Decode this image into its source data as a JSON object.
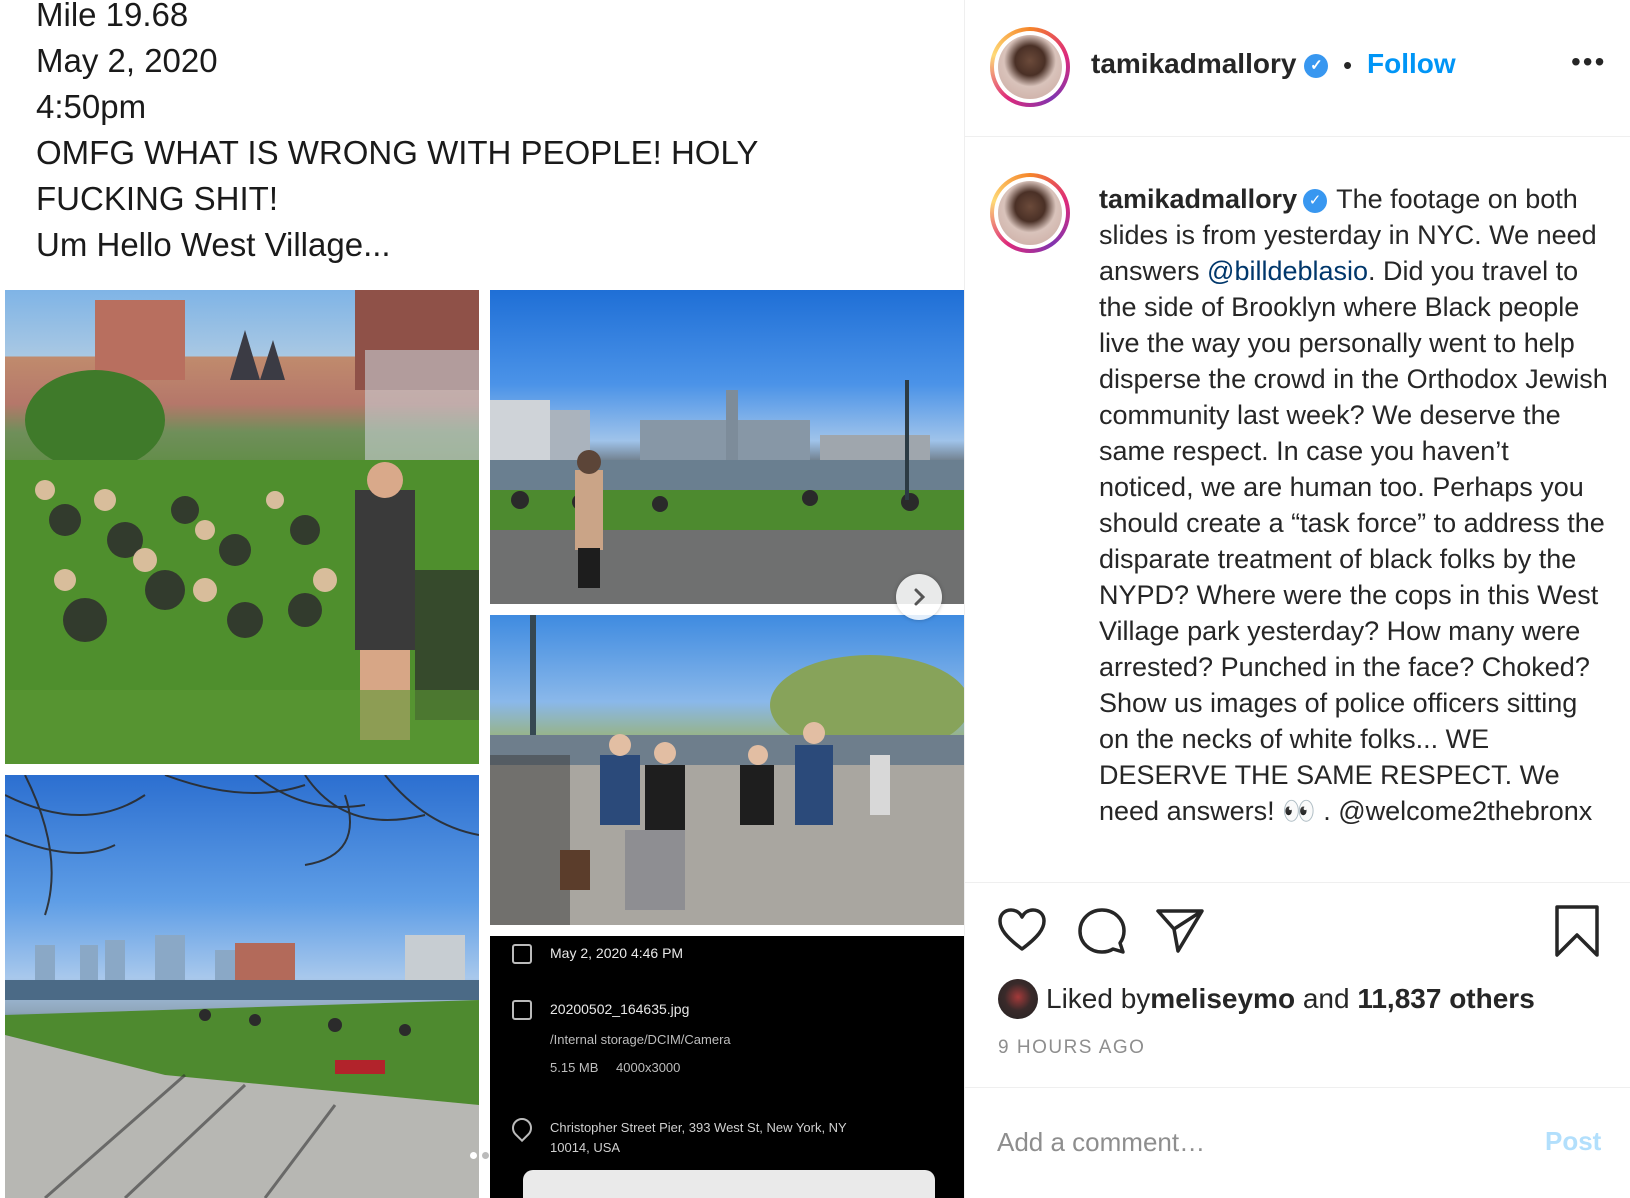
{
  "media": {
    "text_lines": [
      "Mile 19.68",
      "May 2, 2020",
      "4:50pm",
      "OMFG WHAT IS WRONG WITH PEOPLE! HOLY",
      "FUCKING SHIT!",
      "Um Hello West Village..."
    ],
    "photo_meta": {
      "datetime": "May 2, 2020 4:46 PM",
      "filename": "20200502_164635.jpg",
      "path": "/Internal storage/DCIM/Camera",
      "size": "5.15 MB",
      "resolution": "4000x3000",
      "location_line1": "Christopher Street Pier, 393 West St, New York, NY",
      "location_line2": "10014, USA"
    },
    "next_icon": "chevron-right-icon"
  },
  "post": {
    "username": "tamikadmallory",
    "follow_label": "Follow",
    "follow_separator": "•",
    "more_label": "•••",
    "caption_before_mention": " The footage on both slides is from yesterday in NYC. We need answers ",
    "caption_mention": "@billdeblasio",
    "caption_after_mention": ". Did you travel to the side of Brooklyn where Black people live the way you personally went to help disperse the crowd in the Orthodox Jewish community last week? We deserve the same respect. In case you haven’t noticed, we are human too. Perhaps you should create a “task force” to address the disparate treatment of black folks by the NYPD? Where were the cops in this West Village park yesterday? How many were arrested? Punched in the face? Choked? Show us images of police officers sitting on the necks of white folks... WE DESERVE THE SAME RESPECT. We need answers! 👀 . @welcome2thebronx",
    "likes_prefix": "Liked by ",
    "likes_user": "meliseymo",
    "likes_middle": " and ",
    "likes_count": "11,837 others",
    "time_ago": "9 HOURS AGO",
    "comment_placeholder": "Add a comment…",
    "post_label": "Post"
  },
  "colors": {
    "link_blue": "#0095f6",
    "mention_blue": "#00376b",
    "post_disabled": "#b2dffc",
    "verified": "#3897f0"
  }
}
